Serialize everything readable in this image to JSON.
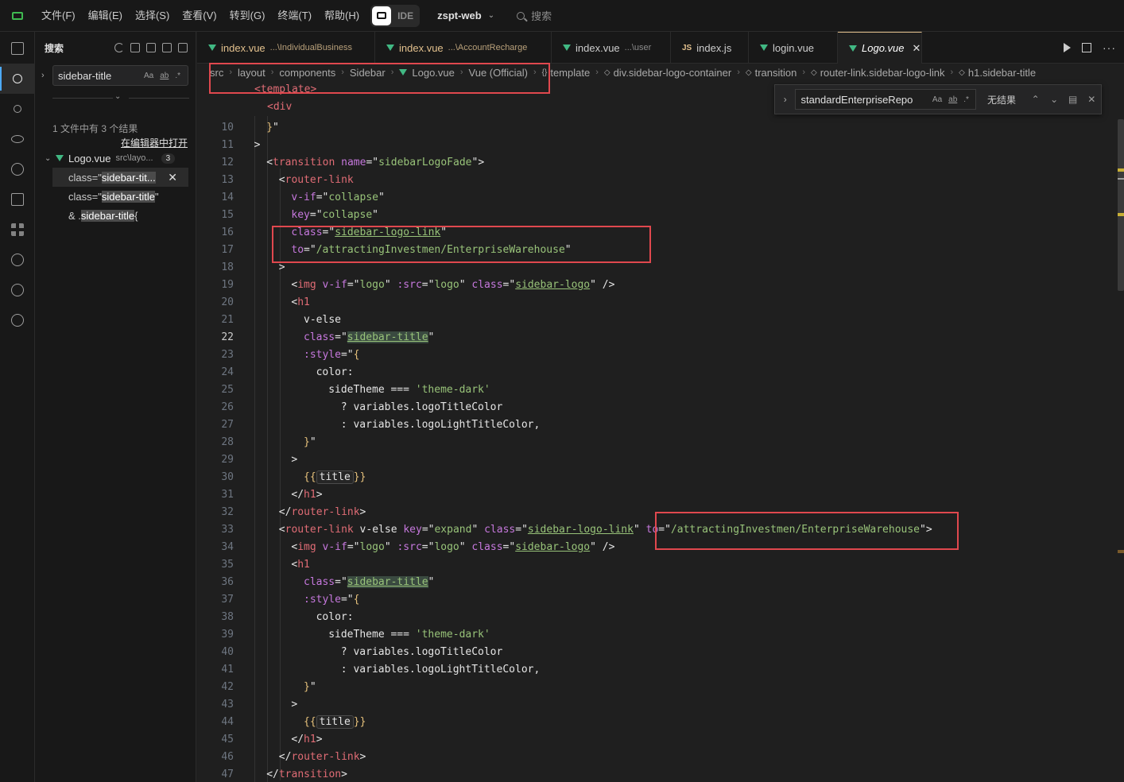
{
  "menu": [
    "文件(F)",
    "编辑(E)",
    "选择(S)",
    "查看(V)",
    "转到(G)",
    "终端(T)",
    "帮助(H)"
  ],
  "ide_label": "IDE",
  "project_name": "zspt-web",
  "top_search_placeholder": "搜索",
  "sidebar": {
    "title": "搜索",
    "search_value": "sidebar-title",
    "opt_case": "Aa",
    "opt_word": "ab",
    "opt_regex": ".*",
    "result_summary": "1 文件中有 3 个结果",
    "open_in_editor": "在编辑器中打开",
    "file": {
      "name": "Logo.vue",
      "path": "src\\layo...",
      "count": "3"
    },
    "matches": [
      {
        "pre": "class=\"",
        "hit": "sidebar-tit...",
        "post": ""
      },
      {
        "pre": "class=\"",
        "hit": "sidebar-title",
        "post": "\""
      },
      {
        "pre": "& .",
        "hit": "sidebar-title",
        "post": " {"
      }
    ]
  },
  "tabs": [
    {
      "name": "index.vue",
      "dir": "...\\IndividualBusiness",
      "icon": "vue-icon",
      "modified": true
    },
    {
      "name": "index.vue",
      "dir": "...\\AccountRecharge",
      "icon": "vue-icon",
      "modified": true
    },
    {
      "name": "index.vue",
      "dir": "...\\user",
      "icon": "vue-icon",
      "modified": false
    },
    {
      "name": "index.js",
      "dir": "",
      "icon": "js-icon",
      "icon_text": "JS",
      "modified": false
    },
    {
      "name": "login.vue",
      "dir": "",
      "icon": "vue-icon",
      "modified": false
    },
    {
      "name": "Logo.vue",
      "dir": "",
      "icon": "vue-icon",
      "modified": false,
      "active": true
    }
  ],
  "breadcrumb": [
    "src",
    "layout",
    "components",
    "Sidebar",
    "Logo.vue",
    "Vue (Official)",
    "template",
    "div.sidebar-logo-container",
    "transition",
    "router-link.sidebar-logo-link",
    "h1.sidebar-title"
  ],
  "find": {
    "value": "standardEnterpriseRepo",
    "opt_case": "Aa",
    "opt_word": "ab",
    "opt_regex": ".*",
    "result": "无结果"
  },
  "code": {
    "peek_line_1": "<template>",
    "peek_line_2": "<div",
    "lines": [
      {
        "n": "10",
        "text": "}\""
      },
      {
        "n": "11",
        "text": ">"
      },
      {
        "n": "12",
        "text": "<transition name=\"sidebarLogoFade\">"
      },
      {
        "n": "13",
        "text": "<router-link"
      },
      {
        "n": "14",
        "text": "v-if=\"collapse\""
      },
      {
        "n": "15",
        "text": "key=\"collapse\""
      },
      {
        "n": "16",
        "text": "class=\"sidebar-logo-link\""
      },
      {
        "n": "17",
        "text": "to=\"/attractingInvestmen/EnterpriseWarehouse\""
      },
      {
        "n": "18",
        "text": ">"
      },
      {
        "n": "19",
        "text": "<img v-if=\"logo\" :src=\"logo\" class=\"sidebar-logo\" />"
      },
      {
        "n": "20",
        "text": "<h1"
      },
      {
        "n": "21",
        "text": "v-else"
      },
      {
        "n": "22",
        "text": "class=\"sidebar-title\""
      },
      {
        "n": "23",
        "text": ":style=\"{"
      },
      {
        "n": "24",
        "text": "color:"
      },
      {
        "n": "25",
        "text": "sideTheme === 'theme-dark'"
      },
      {
        "n": "26",
        "text": "? variables.logoTitleColor"
      },
      {
        "n": "27",
        "text": ": variables.logoLightTitleColor,"
      },
      {
        "n": "28",
        "text": "}\""
      },
      {
        "n": "29",
        "text": ">"
      },
      {
        "n": "30",
        "text": "{{ title }}"
      },
      {
        "n": "31",
        "text": "</h1>"
      },
      {
        "n": "32",
        "text": "</router-link>"
      },
      {
        "n": "33",
        "text": "<router-link v-else key=\"expand\" class=\"sidebar-logo-link\" to=\"/attractingInvestmen/EnterpriseWarehouse\">"
      },
      {
        "n": "34",
        "text": "<img v-if=\"logo\" :src=\"logo\" class=\"sidebar-logo\" />"
      },
      {
        "n": "35",
        "text": "<h1"
      },
      {
        "n": "36",
        "text": "class=\"sidebar-title\""
      },
      {
        "n": "37",
        "text": ":style=\"{"
      },
      {
        "n": "38",
        "text": "color:"
      },
      {
        "n": "39",
        "text": "sideTheme === 'theme-dark'"
      },
      {
        "n": "40",
        "text": "? variables.logoTitleColor"
      },
      {
        "n": "41",
        "text": ": variables.logoLightTitleColor,"
      },
      {
        "n": "42",
        "text": "}\""
      },
      {
        "n": "43",
        "text": ">"
      },
      {
        "n": "44",
        "text": "{{ title }}"
      },
      {
        "n": "45",
        "text": "</h1>"
      },
      {
        "n": "46",
        "text": "</router-link>"
      },
      {
        "n": "47",
        "text": "</transition>"
      }
    ]
  },
  "colors": {
    "accent": "#4daafc",
    "annotation": "#e0484e",
    "vue": "#41b883",
    "modified_tab": "#e2c08d"
  },
  "icons": [
    "explorer-icon",
    "search-icon",
    "source-control-icon",
    "preview-icon",
    "debug-icon",
    "remote-icon",
    "extensions-icon",
    "ai-icon",
    "timeline-icon",
    "openai-icon"
  ]
}
